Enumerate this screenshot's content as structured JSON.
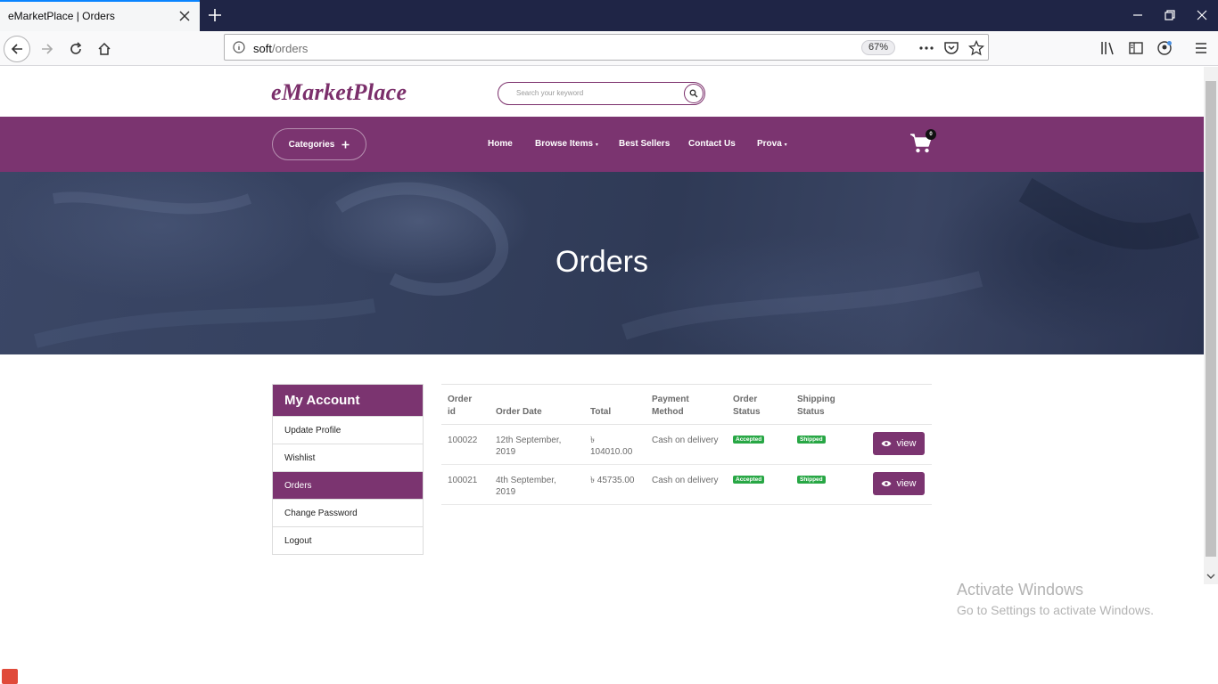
{
  "browser": {
    "tab_title": "eMarketPlace | Orders",
    "url_host": "soft",
    "url_path": "/orders",
    "zoom": "67%"
  },
  "site": {
    "logo": "eMarketPlace",
    "search_placeholder": "Search your keyword",
    "categories_label": "Categories",
    "menu": [
      "Home",
      "Browse Items",
      "Best Sellers",
      "Contact Us",
      "Prova"
    ],
    "cart_count": "0",
    "brand_color": "#7b3470"
  },
  "hero": {
    "title": "Orders"
  },
  "account": {
    "title": "My Account",
    "items": [
      "Update Profile",
      "Wishlist",
      "Orders",
      "Change Password",
      "Logout"
    ],
    "active": "Orders"
  },
  "orders": {
    "headers": {
      "id_1": "Order",
      "id_2": "id",
      "date": "Order Date",
      "total": "Total",
      "pay_1": "Payment",
      "pay_2": "Method",
      "ostatus_1": "Order",
      "ostatus_2": "Status",
      "sstatus_1": "Shipping",
      "sstatus_2": "Status"
    },
    "rows": [
      {
        "id": "100022",
        "date_1": "12th September,",
        "date_2": "2019",
        "total_1": "৳",
        "total_2": "104010.00",
        "payment": "Cash on delivery",
        "order_status": "Accepted",
        "shipping_status": "Shipped",
        "action": "view"
      },
      {
        "id": "100021",
        "date_1": "4th September,",
        "date_2": "2019",
        "total_1": "৳ 45735.00",
        "total_2": "",
        "payment": "Cash on delivery",
        "order_status": "Accepted",
        "shipping_status": "Shipped",
        "action": "view"
      }
    ]
  },
  "os": {
    "watermark_title": "Activate Windows",
    "watermark_sub": "Go to Settings to activate Windows."
  }
}
